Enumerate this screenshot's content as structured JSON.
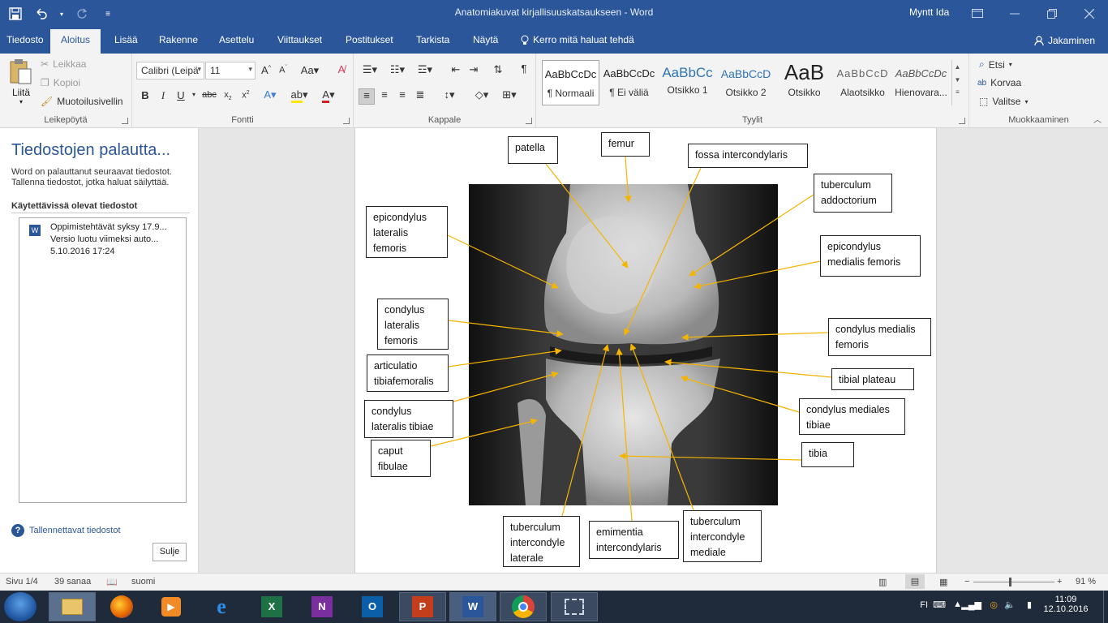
{
  "titlebar": {
    "title": "Anatomiakuvat kirjallisuuskatsaukseen - Word",
    "user": "Myntt Ida"
  },
  "tabs": [
    "Tiedosto",
    "Aloitus",
    "Lisää",
    "Rakenne",
    "Asettelu",
    "Viittaukset",
    "Postitukset",
    "Tarkista",
    "Näytä"
  ],
  "tellme": "Kerro mitä haluat tehdä",
  "share": "Jakaminen",
  "clipboard": {
    "paste": "Liitä",
    "cut": "Leikkaa",
    "copy": "Kopioi",
    "format_painter": "Muotoilusivellin",
    "label": "Leikepöytä"
  },
  "font": {
    "name": "Calibri (Leipä",
    "size": "11",
    "label": "Fontti"
  },
  "paragraph": {
    "label": "Kappale"
  },
  "styles": {
    "label": "Tyylit",
    "items": [
      {
        "preview": "AaBbCcDc",
        "name": "¶ Normaali"
      },
      {
        "preview": "AaBbCcDc",
        "name": "¶ Ei väliä"
      },
      {
        "preview": "AaBbCc",
        "name": "Otsikko 1"
      },
      {
        "preview": "AaBbCcD",
        "name": "Otsikko 2"
      },
      {
        "preview": "AaB",
        "name": "Otsikko"
      },
      {
        "preview": "AaBbCcD",
        "name": "Alaotsikko"
      },
      {
        "preview": "AaBbCcDc",
        "name": "Hienovara..."
      }
    ]
  },
  "editing": {
    "find": "Etsi",
    "replace": "Korvaa",
    "select": "Valitse",
    "label": "Muokkaaminen"
  },
  "recovery": {
    "title": "Tiedostojen palautta...",
    "desc_line1": "Word on palauttanut seuraavat tiedostot.",
    "desc_line2": "Tallenna tiedostot, jotka haluat säilyttää.",
    "available": "Käytettävissä olevat tiedostot",
    "file_line1": "Oppimistehtävät syksy 17.9...",
    "file_line2": "Versio luotu viimeksi auto...",
    "file_line3": "5.10.2016 17:24",
    "help": "Tallennettavat tiedostot",
    "close": "Sulje"
  },
  "labels": {
    "patella": "patella",
    "femur": "femur",
    "fossa": "fossa intercondylaris",
    "tub_add_1": "tuberculum",
    "tub_add_2": "addoctorium",
    "epi_lat_1": "epicondylus",
    "epi_lat_2": "lateralis",
    "epi_lat_3": "femoris",
    "epi_med_1": "epicondylus",
    "epi_med_2": "medialis femoris",
    "cond_lat_1": "condylus",
    "cond_lat_2": "lateralis",
    "cond_lat_3": "femoris",
    "cond_med_1": "condylus medialis",
    "cond_med_2": "femoris",
    "artic_1": "articulatio",
    "artic_2": "tibiafemoralis",
    "tibial_plateau": "tibial plateau",
    "cond_lat_tib_1": "condylus",
    "cond_lat_tib_2": "lateralis tibiae",
    "cond_med_tib_1": "condylus mediales",
    "cond_med_tib_2": "tibiae",
    "caput_1": "caput",
    "caput_2": "fibulae",
    "tibia": "tibia",
    "tub_lat_1": "tuberculum",
    "tub_lat_2": "intercondyle",
    "tub_lat_3": "laterale",
    "emin_1": "emimentia",
    "emin_2": "intercondylaris",
    "tub_med_1": "tuberculum",
    "tub_med_2": "intercondyle",
    "tub_med_3": "mediale"
  },
  "status": {
    "page": "Sivu 1/4",
    "words": "39 sanaa",
    "language": "suomi",
    "zoom": "91 %"
  },
  "taskbar": {
    "lang": "FI",
    "time": "11:09",
    "date": "12.10.2016"
  },
  "colors": {
    "word_blue": "#2b579a",
    "arrow": "#f5b400"
  }
}
